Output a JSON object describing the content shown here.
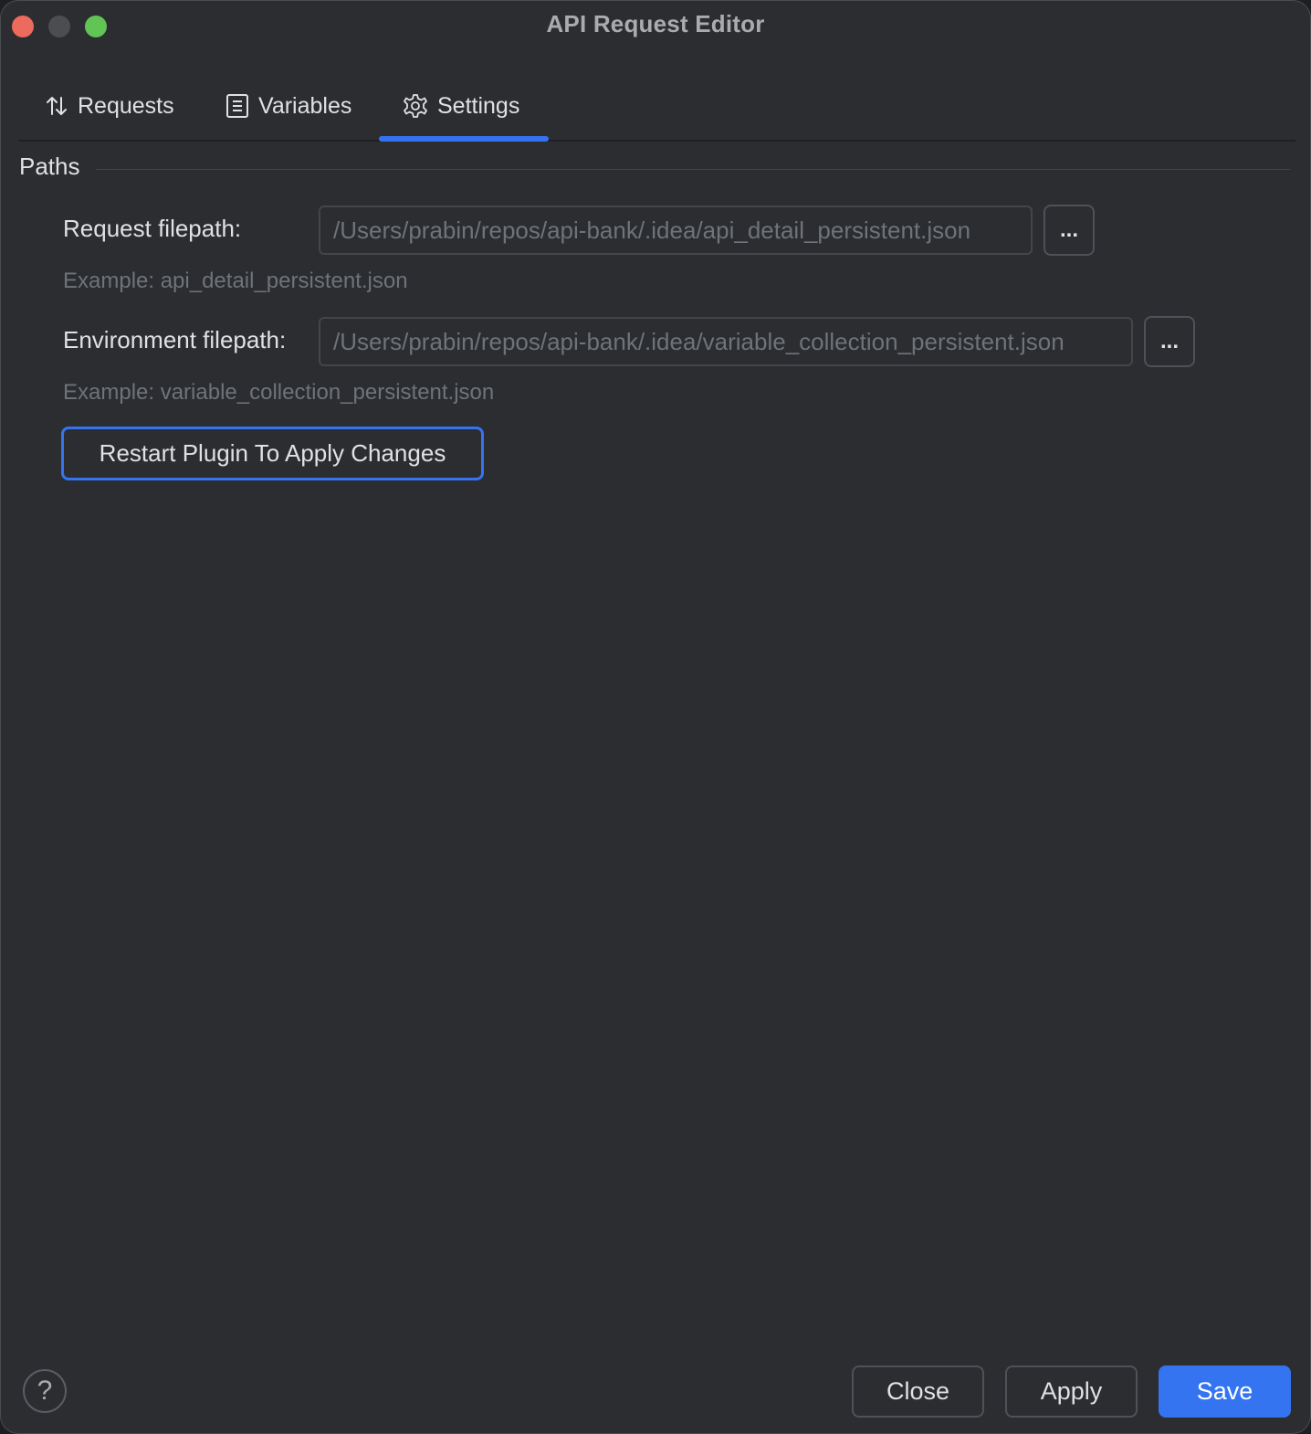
{
  "window": {
    "title": "API Request Editor"
  },
  "tabs": [
    {
      "label": "Requests",
      "icon": "sort-arrows-icon",
      "selected": false
    },
    {
      "label": "Variables",
      "icon": "document-icon",
      "selected": false
    },
    {
      "label": "Settings",
      "icon": "gear-icon",
      "selected": true
    }
  ],
  "section": {
    "title": "Paths"
  },
  "request_path": {
    "label": "Request filepath:",
    "value": "/Users/prabin/repos/api-bank/.idea/api_detail_persistent.json",
    "browse_label": "...",
    "example": "Example: api_detail_persistent.json"
  },
  "environment_path": {
    "label": "Environment filepath:",
    "value": "/Users/prabin/repos/api-bank/.idea/variable_collection_persistent.json",
    "browse_label": "...",
    "example": "Example: variable_collection_persistent.json"
  },
  "restart_button": {
    "label": "Restart Plugin To Apply Changes"
  },
  "footer": {
    "help_label": "?",
    "close_label": "Close",
    "apply_label": "Apply",
    "save_label": "Save"
  },
  "colors": {
    "background": "#2b2d30",
    "accent": "#3574f0",
    "text": "#dfe1e5",
    "muted_text": "#6f737a",
    "traffic_close": "#ed6a5e",
    "traffic_max": "#61c454"
  }
}
